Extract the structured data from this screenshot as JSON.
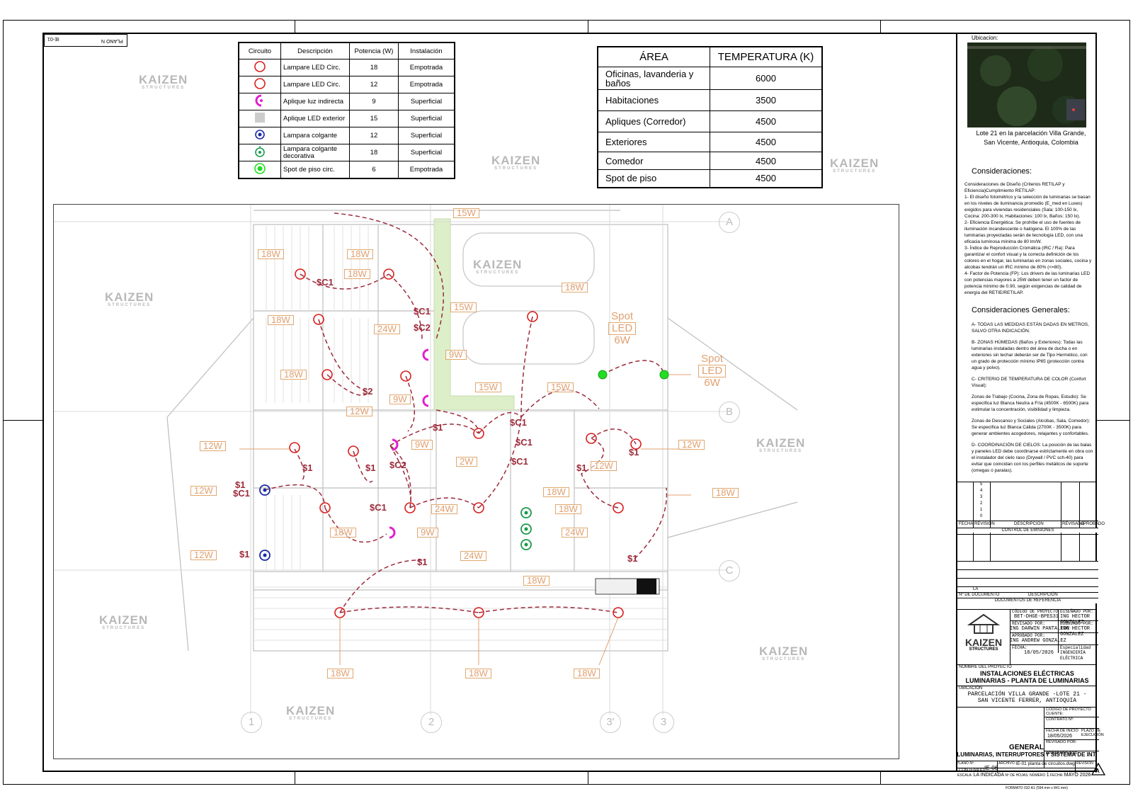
{
  "sheet_code": "IE-01",
  "plan_code_mirrored": "PLANO N",
  "legend": {
    "headers": [
      "Circuito",
      "Descripción",
      "Potencia (W)",
      "Instalación"
    ],
    "rows": [
      {
        "symbol": "ring-red",
        "desc": "Lampare LED Circ.",
        "power": "18",
        "install": "Empotrada",
        "color": "#d81d1d"
      },
      {
        "symbol": "ring-red",
        "desc": "Lampare LED Circ.",
        "power": "12",
        "install": "Empotrada",
        "color": "#d81d1d"
      },
      {
        "symbol": "half-magenta",
        "desc": "Aplique luz indirecta",
        "power": "9",
        "install": "Superficial",
        "color": "#e020d0"
      },
      {
        "symbol": "square-gray",
        "desc": "Aplique LED exterior",
        "power": "15",
        "install": "Superficial",
        "color": "#cccccc"
      },
      {
        "symbol": "target-blue",
        "desc": "Lampara colgante",
        "power": "12",
        "install": "Superficial",
        "color": "#1a2aa8"
      },
      {
        "symbol": "pendant-green",
        "desc": "Lampara colgante decorativa",
        "power": "18",
        "install": "Superficial",
        "color": "#1a9a4a"
      },
      {
        "symbol": "spot-green",
        "desc": "Spot de piso circ.",
        "power": "6",
        "install": "Empotrada",
        "color": "#22dd22"
      }
    ]
  },
  "temperature_table": {
    "headers": [
      "ÁREA",
      "TEMPERATURA (K)"
    ],
    "rows": [
      {
        "area": "Oficinas, lavanderia y baños",
        "temp": "6000"
      },
      {
        "area": "Habitaciones",
        "temp": "3500"
      },
      {
        "area": "Apliques (Corredor)",
        "temp": "4500"
      },
      {
        "area": "Exteriores",
        "temp": "4500"
      },
      {
        "area": "Comedor",
        "temp": "4500"
      },
      {
        "area": "Spot de piso",
        "temp": "4500"
      }
    ]
  },
  "watermark": {
    "brand": "KAIZEN",
    "sub": "STRUCTURES"
  },
  "plan": {
    "axis_letters": [
      "A",
      "B",
      "C"
    ],
    "axis_numbers": [
      "1",
      "2",
      "3'",
      "3"
    ],
    "spot_label": [
      "Spot",
      "LED",
      "6W"
    ],
    "wattage_labels": [
      "15W",
      "18W",
      "18W",
      "18W",
      "18W",
      "15W",
      "18W",
      "24W",
      "9W",
      "18W",
      "15W",
      "15W",
      "9W",
      "12W",
      "9W",
      "12W",
      "12W",
      "12W",
      "12W",
      "2W",
      "12W",
      "24W",
      "18W",
      "18W",
      "18W",
      "24W",
      "18W",
      "12W",
      "9W",
      "24W",
      "18W",
      "15W",
      "18W",
      "18W",
      "18W"
    ],
    "switch_labels": [
      "$C1",
      "$C1",
      "$C2",
      "$2",
      "$1",
      "$C1",
      "$C1",
      "$1",
      "$1",
      "$1",
      "$C2",
      "$C1",
      "$C1",
      "$1",
      "$1",
      "$C1",
      "$1",
      "$1",
      "$1",
      "$1"
    ]
  },
  "title_block": {
    "ubicacion_label": "Ubicacion:",
    "ubicacion_caption": "Lote 21 en la parcelación Villa Grande, San Vicente, Antioquia, Colombia",
    "consideraciones_title": "Consideraciones:",
    "consideraciones_intro": "Consideraciones de Diseño (Criterios RETILAP y Eficiencia)Cumplimiento RETILAP:",
    "consideraciones_items": [
      "1- El diseño fotométrico y la selección de luminarias se basan en los niveles de iluminancia promedio (E_med en Luxes) exigidos para viviendas residenciales (Sala: 100-150 lx, Cocina: 200-300 lx, Habitaciones: 100 lx, Baños: 150 lx).",
      "2- Eficiencia Energética: Se prohíbe el uso de fuentes de iluminación incandescente o halógena. El 100% de las luminarias proyectadas serán de tecnología LED, con una eficacia luminosa mínima de 80 lm/W.",
      "3- Índice de Reproducción Cromática (IRC / Ra): Para garantizar el confort visual y la correcta definición de los colores en el hogar, las luminarias en zonas sociales, cocina y alcobas tendrán un IRC mínimo de 80% (<=80).",
      "4- Factor de Potencia (FP): Los drivers de las luminarias LED con potencias mayores a 25W deben tener un factor de potencia mínimo de 0.90, según exigencias de calidad de energía del RETIE/RETILAP."
    ],
    "generales_title": "Consideraciones Generales:",
    "generales_items": [
      "A- TODAS LAS MEDIDAS ESTÁN DADAS EN METROS, SALVO OTRA INDICACIÓN.",
      "B- ZONAS HÚMEDAS (Baños y Exteriores): Todas las luminarias instaladas dentro del área de ducha o en exteriores sin techar deberán ser de Tipo Hermético, con un grado de protección mínimo IP65 (protección contra agua y polvo).",
      "C- CRITERIO DE TEMPERATURA DE COLOR (Confort Visual):",
      "Zonas de Trabajo (Cocina, Zona de Ropas, Estudio): Se especifica luz Blanca Neutra a Fría (4500K - 6500K) para estimular la concentración, visibilidad y limpieza.",
      "Zonas de Descanso y Sociales (Alcobas, Sala, Comedor): Se especifica luz Blanca Cálida (2700K - 3500K) para generar ambientes acogedores, relajantes y confortables.",
      "D- COORDINACIÓN DE CIELOS: La posición de las balas y paneles LED debe coordinarse estrictamente en obra con el instalador del cielo raso (Drywall / PVC sch-40) para evitar que coincidan con los perfiles metálicos de soporte (omegas o paralas)."
    ],
    "revision_numbers": [
      "5",
      "4",
      "3",
      "2",
      "1",
      "0"
    ],
    "revision_headers": [
      "FECHA",
      "REVISIÓN",
      "DESCRIPCIÓN",
      "REVISADO",
      "APROBADO"
    ],
    "control_emisiones": "CONTROL DE EMISIONES",
    "la": "LA",
    "doc_headers": [
      "Nº DE DOCUMENTO",
      "DESCRIPCIÓN"
    ],
    "docs_ref": "DOCUMENTOS DE REFERENCIA",
    "codigo_label": "CÓDIGO DE PROYECTO",
    "codigo": "BET-DHGE-BPES31",
    "disenado_label": "DISEÑADO POR:",
    "disenado": "ING HECTOR GONZALEZ",
    "revisado_label": "REVISADO POR:",
    "revisado": "ING DARWIN PANTALEON",
    "dibujado_label": "DIBUJADO POR:",
    "dibujado": "ING HECTOR GONZALEZ",
    "aprobado_label": "APROBADO POR:",
    "aprobado": "ING ANDREW GONZALEZ",
    "fecha_label": "FECHA:",
    "fecha": "18/05/2026",
    "especialidad_label": "Especialidad",
    "especialidad": "INGENIERÍA ELÉCTRICA",
    "nombre_label": "NOMBRE DEL PROYECTO",
    "nombre_l1": "INSTALACIONES ELÉCTRICAS",
    "nombre_l2": "LUMINARIAS - PLANTA DE LUMINARIAS",
    "ubicacion2_label": "UBICACIÓN",
    "ubicacion2_l1": "PARCELACIÓN VILLA GRANDE -LOTE 21 -",
    "ubicacion2_l2": "SAN VICENTE FERRER, ANTIOQUIA",
    "cliente_label": "CÓDIGO DE PROYECTO CLIENTE:",
    "contrato_label": "CONTRATO Nº:",
    "fecha_inicio_label": "FECHA DE INICIO",
    "fecha_inicio": "18/05/2026",
    "plazo_label": "PLAZO DE EJECUCIÓN",
    "revisado_por_label": "REVISADO POR:",
    "aprobado_por_label": "APROBADO POR:",
    "contenido_label": "CONTENIDO",
    "contenido_l1": "GENERAL",
    "contenido_l2": "LUMINARIAS, INTERRUPTORES Y SISTEMA DE INT",
    "plano_label": "PLANO Nº:",
    "plano": "IE-06",
    "archivo_label": "ARCHIVO",
    "archivo": "IE-01 planta de circuitos.dwg",
    "revision_label": "REVISIÓN",
    "revision": "A",
    "escala_label": "ESCALA:",
    "escala": "LA INDICADA",
    "hojas_label": "Nº DE HOJAS:",
    "numero_label": "NÚMERO",
    "numero": "1",
    "fecha2_label": "FECHA:",
    "fecha2": "MAYO 2026",
    "formato": "FORMATO ISO A1 (594 mm x 841 mm)"
  }
}
